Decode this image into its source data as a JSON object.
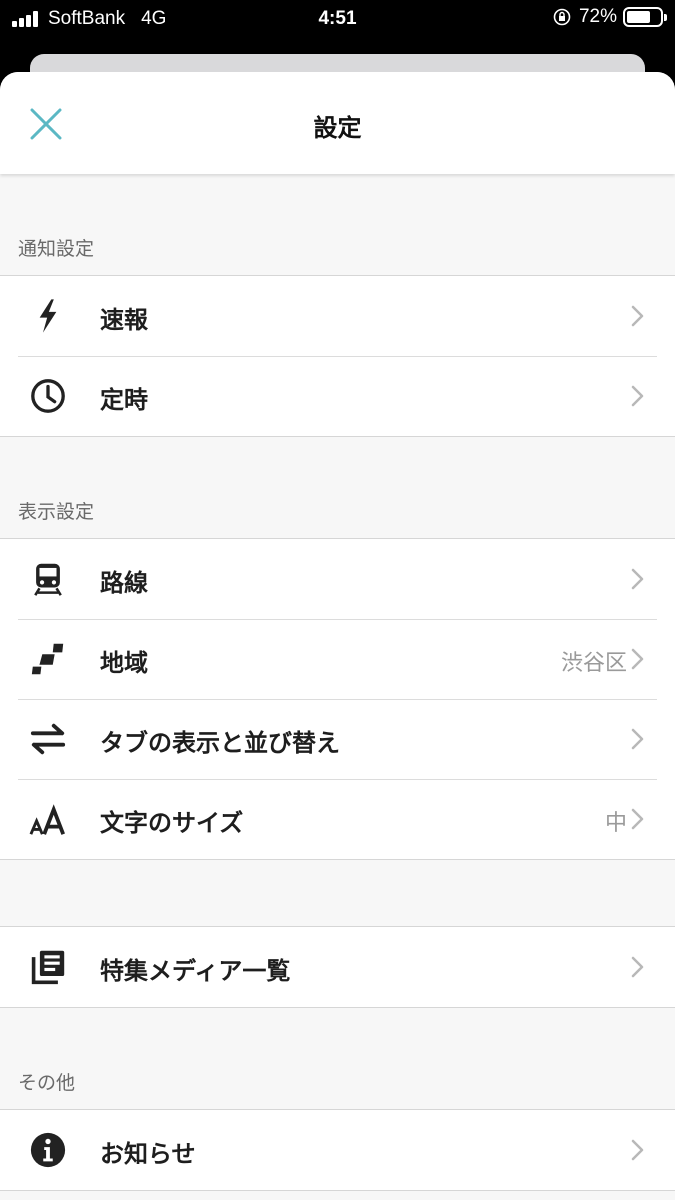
{
  "status_bar": {
    "carrier": "SoftBank",
    "network": "4G",
    "time": "4:51",
    "battery": "72%",
    "battery_level": 0.72
  },
  "header": {
    "title": "設定",
    "close_icon": "close-icon"
  },
  "sections": {
    "notifications": {
      "title": "通知設定",
      "items": [
        {
          "label": "速報",
          "icon": "lightning-icon"
        },
        {
          "label": "定時",
          "icon": "clock-icon"
        }
      ]
    },
    "display": {
      "title": "表示設定",
      "items": [
        {
          "label": "路線",
          "icon": "train-icon"
        },
        {
          "label": "地域",
          "icon": "map-region-icon",
          "value": "渋谷区"
        },
        {
          "label": "タブの表示と並び替え",
          "icon": "swap-arrows-icon"
        },
        {
          "label": "文字のサイズ",
          "icon": "font-size-icon",
          "value": "中"
        }
      ]
    },
    "media": {
      "items": [
        {
          "label": "特集メディア一覧",
          "icon": "library-icon"
        }
      ]
    },
    "other": {
      "title": "その他",
      "items": [
        {
          "label": "お知らせ",
          "icon": "info-icon"
        }
      ]
    }
  },
  "colors": {
    "accent": "#5bb8c4",
    "background": "#f7f7f7",
    "chevron": "#b8b8b8"
  }
}
